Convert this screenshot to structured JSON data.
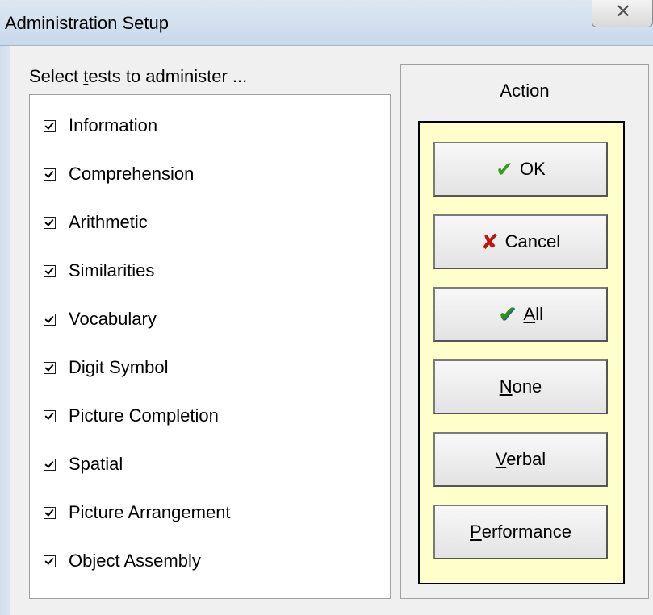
{
  "window": {
    "title": "Administration Setup",
    "close_glyph": "☒"
  },
  "tests": {
    "label_pre": "Select ",
    "label_accel": "t",
    "label_post": "ests to administer ...",
    "items": [
      {
        "label": "Information",
        "checked": true
      },
      {
        "label": "Comprehension",
        "checked": true
      },
      {
        "label": "Arithmetic",
        "checked": true
      },
      {
        "label": "Similarities",
        "checked": true
      },
      {
        "label": "Vocabulary",
        "checked": true
      },
      {
        "label": "Digit Symbol",
        "checked": true
      },
      {
        "label": "Picture Completion",
        "checked": true
      },
      {
        "label": "Spatial",
        "checked": true
      },
      {
        "label": "Picture Arrangement",
        "checked": true
      },
      {
        "label": "Object Assembly",
        "checked": true
      }
    ]
  },
  "action": {
    "title": "Action",
    "ok": {
      "icon": "check-icon",
      "label": "OK"
    },
    "cancel": {
      "icon": "x-icon",
      "label": "Cancel"
    },
    "all": {
      "icon": "double-check-icon",
      "accel": "A",
      "rest": "ll"
    },
    "none": {
      "accel": "N",
      "rest": "one"
    },
    "verbal": {
      "accel": "V",
      "rest": "erbal"
    },
    "performance": {
      "accel": "P",
      "rest": "erformance"
    }
  },
  "colors": {
    "action_panel_bg": "#ffffcc",
    "ok_icon": "#3a9a1e",
    "cancel_icon": "#c0150c"
  }
}
